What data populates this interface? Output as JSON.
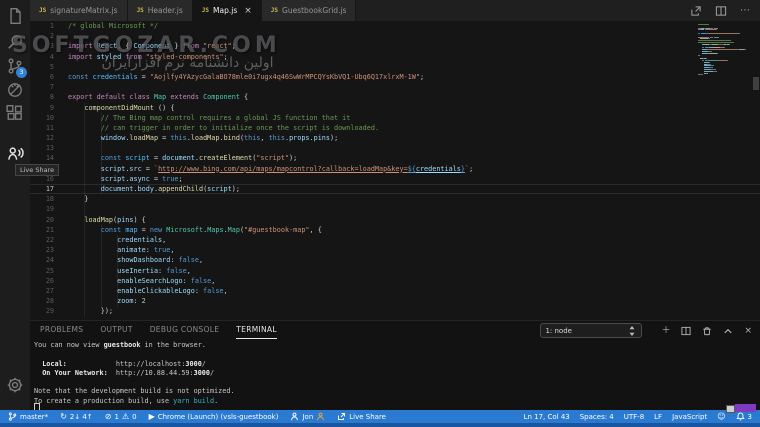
{
  "watermark": {
    "title": "SOFTGOZAR.COM",
    "subtitle": "اولین دانشنامه نرم افزارایران"
  },
  "activity_bar": {
    "source_control_badge": "3",
    "tooltip": "Live Share"
  },
  "tabs": [
    {
      "label": "signatureMatrix.js",
      "icon": "JS",
      "active": false
    },
    {
      "label": "Header.js",
      "icon": "JS",
      "active": false
    },
    {
      "label": "Map.js",
      "icon": "JS",
      "active": true,
      "close": "×"
    },
    {
      "label": "GuestbookGrid.js",
      "icon": "JS",
      "active": false
    }
  ],
  "editor_actions": {
    "ellipsis": "⋯"
  },
  "editor": {
    "current_line": 17,
    "lines": [
      {
        "t": [
          [
            "cm",
            "/* global Microsoft */"
          ]
        ]
      },
      {
        "t": []
      },
      {
        "t": [
          [
            "kw",
            "import"
          ],
          [
            "pl",
            " "
          ],
          [
            "id",
            "React"
          ],
          [
            "pl",
            ", { "
          ],
          [
            "id",
            "Component"
          ],
          [
            "pl",
            " } "
          ],
          [
            "kw",
            "from"
          ],
          [
            "pl",
            " "
          ],
          [
            "st",
            "\"react\""
          ],
          [
            "pl",
            ";"
          ]
        ]
      },
      {
        "t": [
          [
            "kw",
            "import"
          ],
          [
            "pl",
            " "
          ],
          [
            "id",
            "styled"
          ],
          [
            "pl",
            " "
          ],
          [
            "kw",
            "from"
          ],
          [
            "pl",
            " "
          ],
          [
            "st",
            "\"styled-components\""
          ],
          [
            "pl",
            ";"
          ]
        ]
      },
      {
        "t": []
      },
      {
        "t": [
          [
            "kb",
            "const"
          ],
          [
            "pl",
            " "
          ],
          [
            "cv",
            "credentials"
          ],
          [
            "pl",
            " = "
          ],
          [
            "st",
            "\"Aojlfy4YAzycGalaBO78mle0i7ugx4q46SwWrMPCQYsKbVQ1-Ubq6Q17xlrxM-1W\""
          ],
          [
            "pl",
            ";"
          ]
        ]
      },
      {
        "t": []
      },
      {
        "t": [
          [
            "kw",
            "export"
          ],
          [
            "pl",
            " "
          ],
          [
            "kw",
            "default"
          ],
          [
            "pl",
            " "
          ],
          [
            "kw",
            "class"
          ],
          [
            "pl",
            " "
          ],
          [
            "cl",
            "Map"
          ],
          [
            "pl",
            " "
          ],
          [
            "kw",
            "extends"
          ],
          [
            "pl",
            " "
          ],
          [
            "cl",
            "Component"
          ],
          [
            "pl",
            " {"
          ]
        ]
      },
      {
        "t": [
          [
            "pl",
            "    "
          ],
          [
            "fn",
            "componentDidMount"
          ],
          [
            "pl",
            " () {"
          ]
        ]
      },
      {
        "t": [
          [
            "cm",
            "        // The Bing map control requires a global JS function that it"
          ]
        ]
      },
      {
        "t": [
          [
            "cm",
            "        // can trigger in order to initialize once the script is downloaded."
          ]
        ]
      },
      {
        "t": [
          [
            "pl",
            "        "
          ],
          [
            "id",
            "window"
          ],
          [
            "pl",
            "."
          ],
          [
            "fn",
            "loadMap"
          ],
          [
            "pl",
            " = "
          ],
          [
            "kb",
            "this"
          ],
          [
            "pl",
            "."
          ],
          [
            "fn",
            "loadMap"
          ],
          [
            "pl",
            "."
          ],
          [
            "fn",
            "bind"
          ],
          [
            "pl",
            "("
          ],
          [
            "kb",
            "this"
          ],
          [
            "pl",
            ", "
          ],
          [
            "kb",
            "this"
          ],
          [
            "pl",
            "."
          ],
          [
            "id",
            "props"
          ],
          [
            "pl",
            "."
          ],
          [
            "id",
            "pins"
          ],
          [
            "pl",
            ");"
          ]
        ]
      },
      {
        "t": []
      },
      {
        "t": [
          [
            "pl",
            "        "
          ],
          [
            "kb",
            "const"
          ],
          [
            "pl",
            " "
          ],
          [
            "cv",
            "script"
          ],
          [
            "pl",
            " = "
          ],
          [
            "id",
            "document"
          ],
          [
            "pl",
            "."
          ],
          [
            "fn",
            "createElement"
          ],
          [
            "pl",
            "("
          ],
          [
            "st",
            "\"script\""
          ],
          [
            "pl",
            ");"
          ]
        ]
      },
      {
        "t": [
          [
            "pl",
            "        "
          ],
          [
            "id",
            "script"
          ],
          [
            "pl",
            "."
          ],
          [
            "id",
            "src"
          ],
          [
            "pl",
            " = "
          ],
          [
            "st",
            "`"
          ],
          [
            "stu",
            "http://www.bing.com/api/maps/mapcontrol?callback=loadMap&key="
          ],
          [
            "kbu",
            "${"
          ],
          [
            "idu",
            "credentials"
          ],
          [
            "kbu",
            "}"
          ],
          [
            "st",
            "`"
          ],
          [
            "pl",
            ";"
          ]
        ]
      },
      {
        "t": [
          [
            "pl",
            "        "
          ],
          [
            "id",
            "script"
          ],
          [
            "pl",
            "."
          ],
          [
            "id",
            "async"
          ],
          [
            "pl",
            " = "
          ],
          [
            "kb",
            "true"
          ],
          [
            "pl",
            ";"
          ]
        ]
      },
      {
        "t": [
          [
            "pl",
            "        "
          ],
          [
            "id",
            "document"
          ],
          [
            "pl",
            "."
          ],
          [
            "id",
            "body"
          ],
          [
            "pl",
            "."
          ],
          [
            "fn",
            "appendChild"
          ],
          [
            "pl",
            "("
          ],
          [
            "id",
            "script"
          ],
          [
            "pl",
            ");"
          ]
        ]
      },
      {
        "t": [
          [
            "pl",
            "    }"
          ]
        ]
      },
      {
        "t": []
      },
      {
        "t": [
          [
            "pl",
            "    "
          ],
          [
            "fn",
            "loadMap"
          ],
          [
            "pl",
            "("
          ],
          [
            "id",
            "pins"
          ],
          [
            "pl",
            ") {"
          ]
        ]
      },
      {
        "t": [
          [
            "pl",
            "        "
          ],
          [
            "kb",
            "const"
          ],
          [
            "pl",
            " "
          ],
          [
            "cv",
            "map"
          ],
          [
            "pl",
            " = "
          ],
          [
            "kb",
            "new"
          ],
          [
            "pl",
            " "
          ],
          [
            "cl",
            "Microsoft"
          ],
          [
            "pl",
            "."
          ],
          [
            "cl",
            "Maps"
          ],
          [
            "pl",
            "."
          ],
          [
            "cl",
            "Map"
          ],
          [
            "pl",
            "("
          ],
          [
            "st",
            "\"#guestbook-map\""
          ],
          [
            "pl",
            ", {"
          ]
        ]
      },
      {
        "t": [
          [
            "pl",
            "            "
          ],
          [
            "id",
            "credentials"
          ],
          [
            "pl",
            ","
          ]
        ]
      },
      {
        "t": [
          [
            "pl",
            "            "
          ],
          [
            "id",
            "animate"
          ],
          [
            "pl",
            ": "
          ],
          [
            "kb",
            "true"
          ],
          [
            "pl",
            ","
          ]
        ]
      },
      {
        "t": [
          [
            "pl",
            "            "
          ],
          [
            "id",
            "showDashboard"
          ],
          [
            "pl",
            ": "
          ],
          [
            "kb",
            "false"
          ],
          [
            "pl",
            ","
          ]
        ]
      },
      {
        "t": [
          [
            "pl",
            "            "
          ],
          [
            "id",
            "useInertia"
          ],
          [
            "pl",
            ": "
          ],
          [
            "kb",
            "false"
          ],
          [
            "pl",
            ","
          ]
        ]
      },
      {
        "t": [
          [
            "pl",
            "            "
          ],
          [
            "id",
            "enableSearchLogo"
          ],
          [
            "pl",
            ": "
          ],
          [
            "kb",
            "false"
          ],
          [
            "pl",
            ","
          ]
        ]
      },
      {
        "t": [
          [
            "pl",
            "            "
          ],
          [
            "id",
            "enableClickableLogo"
          ],
          [
            "pl",
            ": "
          ],
          [
            "kb",
            "false"
          ],
          [
            "pl",
            ","
          ]
        ]
      },
      {
        "t": [
          [
            "pl",
            "            "
          ],
          [
            "id",
            "zoom"
          ],
          [
            "pl",
            ": "
          ],
          [
            "nu",
            "2"
          ]
        ]
      },
      {
        "t": [
          [
            "pl",
            "        });"
          ]
        ]
      }
    ]
  },
  "panel": {
    "tabs": [
      {
        "label": "PROBLEMS",
        "active": false
      },
      {
        "label": "OUTPUT",
        "active": false
      },
      {
        "label": "DEBUG CONSOLE",
        "active": false
      },
      {
        "label": "TERMINAL",
        "active": true
      }
    ],
    "terminal_select": "1: node",
    "terminal_lines": [
      [
        [
          "You can now view ",
          ""
        ],
        [
          "guestbook",
          "b"
        ],
        [
          " in the browser.",
          ""
        ]
      ],
      [],
      [
        [
          "  ",
          ""
        ],
        [
          "Local:",
          "b"
        ],
        [
          "            http://localhost:",
          ""
        ],
        [
          "3000",
          "b"
        ],
        [
          "/",
          ""
        ]
      ],
      [
        [
          "  ",
          ""
        ],
        [
          "On Your Network:",
          "b"
        ],
        [
          "  http://10.88.44.59:",
          ""
        ],
        [
          "3000",
          "b"
        ],
        [
          "/",
          ""
        ]
      ],
      [],
      [
        [
          "Note that the development build is not optimized.",
          ""
        ]
      ],
      [
        [
          "To create a production build, use ",
          ""
        ],
        [
          "yarn build",
          "c"
        ],
        [
          ".",
          ""
        ]
      ]
    ]
  },
  "status_bar": {
    "left": [
      {
        "label": "master*"
      },
      {
        "label": "2↓ 4↑"
      },
      {
        "error": "1",
        "warning": "0"
      },
      {
        "label": "Chrome (Launch) (vsls-guestbook)"
      },
      {
        "label": "Jon"
      },
      {
        "label": "Live Share"
      }
    ],
    "right": [
      {
        "label": "Ln 17, Col 43"
      },
      {
        "label": "Spaces: 4"
      },
      {
        "label": "UTF-8"
      },
      {
        "label": "LF"
      },
      {
        "label": "JavaScript"
      },
      {
        "label": "3"
      }
    ]
  },
  "colors": {
    "status_bar": "#2b7ad2",
    "activity_badge": "#2e83d6",
    "liveshare_tag": "#7e3bc0",
    "js_tab_icon": "#d8ba4a"
  }
}
